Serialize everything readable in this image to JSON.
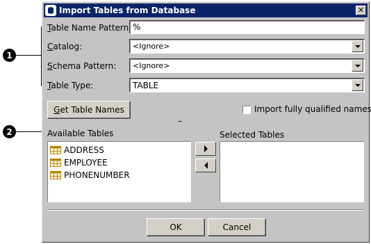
{
  "callouts": [
    "1",
    "2"
  ],
  "dialog": {
    "title": "Import Tables from Database",
    "close_symbol": "✕"
  },
  "form": {
    "table_name_pattern": {
      "label_prefix": "",
      "label_mnemonic": "T",
      "label_rest": "able Name Pattern:",
      "value": "%"
    },
    "catalog": {
      "label_prefix": "",
      "label_mnemonic": "C",
      "label_rest": "atalog:",
      "value": "<Ignore>"
    },
    "schema_pattern": {
      "label_prefix": "",
      "label_mnemonic": "S",
      "label_rest": "chema Pattern:",
      "value": "<Ignore>"
    },
    "table_type": {
      "label_prefix": "",
      "label_mnemonic": "T",
      "label_rest": "able Type:",
      "value": "TABLE"
    }
  },
  "get_table_names": {
    "mnemonic": "G",
    "rest": "et Table Names"
  },
  "import_fully_qualified": {
    "label": "Import fully qualified names",
    "checked": false
  },
  "status_dash": "–",
  "available_tables": {
    "label": "Available Tables",
    "items": [
      "ADDRESS",
      "EMPLOYEE",
      "PHONENUMBER"
    ]
  },
  "selected_tables": {
    "label": "Selected Tables",
    "items": []
  },
  "buttons": {
    "ok": "OK",
    "cancel": "Cancel"
  },
  "icons": {
    "title_icon": "database-import-icon",
    "table_icon": "table-icon",
    "add_arrow": "arrow-right-icon",
    "remove_arrow": "arrow-left-icon",
    "dropdown": "chevron-down-icon"
  },
  "colors": {
    "titlebar": "#0a246a",
    "dialog_bg": "#c4c4c4",
    "table_icon": "#b8860b"
  }
}
